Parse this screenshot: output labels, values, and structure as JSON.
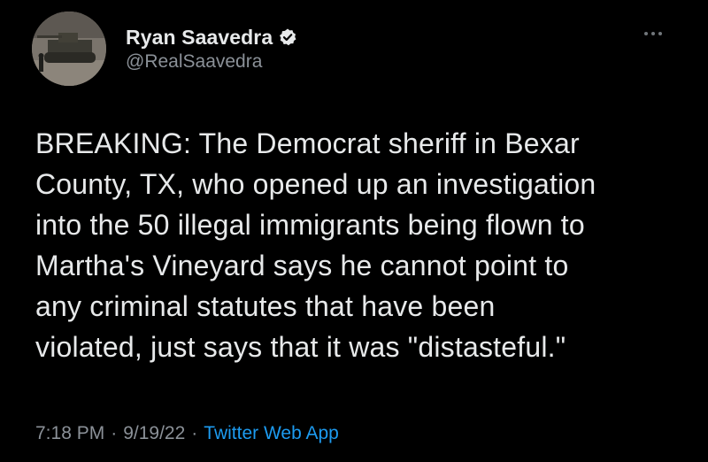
{
  "tweet": {
    "author": {
      "display_name": "Ryan Saavedra",
      "handle": "@RealSaavedra",
      "verified": true,
      "avatar_icon": "tank-photo-avatar"
    },
    "more_icon": "more-horizontal-icon",
    "text": "BREAKING: The Democrat sheriff in Bexar\nCounty, TX, who opened up an investigation\ninto the 50 illegal immigrants being flown to\nMartha's Vineyard says he cannot point to\nany criminal statutes that have been\nviolated, just says that it was \"distasteful.\"",
    "time": "7:18 PM",
    "date": "9/19/22",
    "separator": "·",
    "source": "Twitter Web App"
  },
  "colors": {
    "background": "#000000",
    "primary_text": "#e7e9ea",
    "secondary_text": "#8b9198",
    "link": "#1d9bf0",
    "verified_badge": "#e7e9ea"
  }
}
